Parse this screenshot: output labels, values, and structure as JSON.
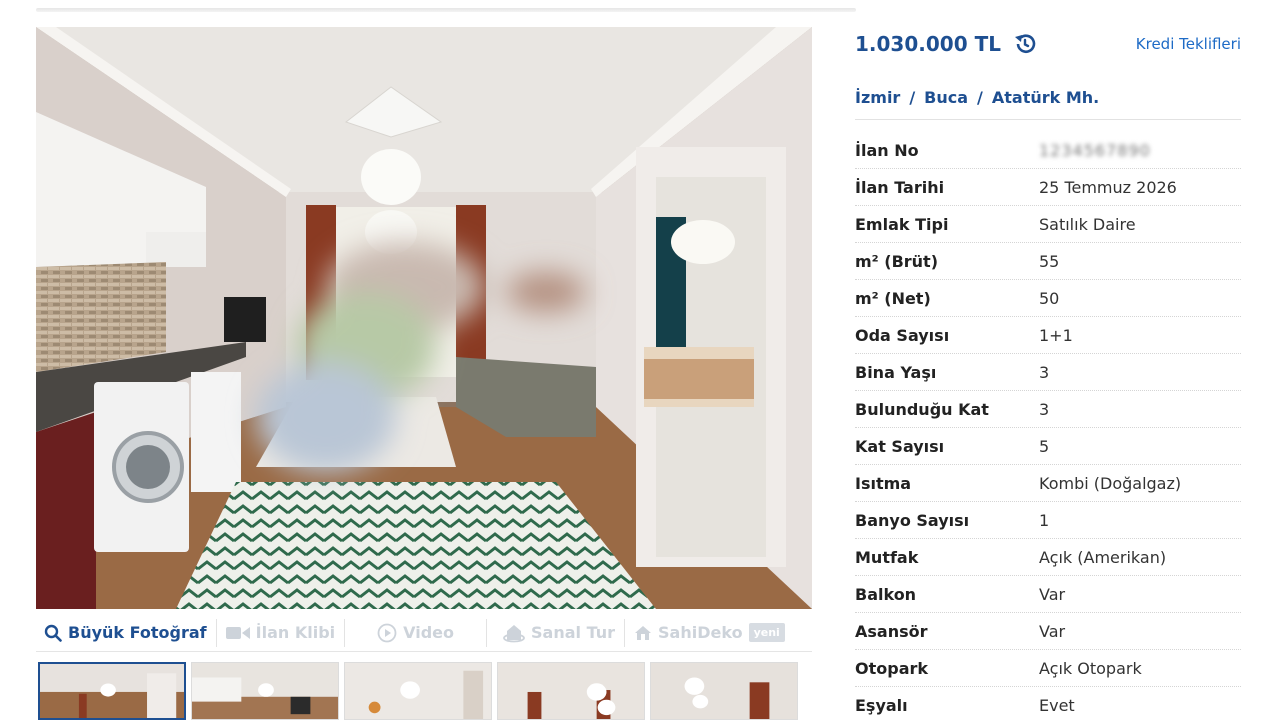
{
  "listing": {
    "price": "1.030.000 TL",
    "price_history_icon": "history-icon",
    "loan_link": "Kredi Teklifleri",
    "breadcrumb": [
      "İzmir",
      "Buca",
      "Atatürk Mh."
    ],
    "breadcrumb_separator": "/",
    "details": [
      {
        "label": "İlan No",
        "value": "1234567890",
        "blurred": true
      },
      {
        "label": "İlan Tarihi",
        "value": "25 Temmuz 2026"
      },
      {
        "label": "Emlak Tipi",
        "value": "Satılık Daire"
      },
      {
        "label": "m² (Brüt)",
        "value": "55"
      },
      {
        "label": "m² (Net)",
        "value": "50"
      },
      {
        "label": "Oda Sayısı",
        "value": "1+1"
      },
      {
        "label": "Bina Yaşı",
        "value": "3"
      },
      {
        "label": "Bulunduğu Kat",
        "value": "3"
      },
      {
        "label": "Kat Sayısı",
        "value": "5"
      },
      {
        "label": "Isıtma",
        "value": "Kombi (Doğalgaz)"
      },
      {
        "label": "Banyo Sayısı",
        "value": "1"
      },
      {
        "label": "Mutfak",
        "value": "Açık (Amerikan)"
      },
      {
        "label": "Balkon",
        "value": "Var"
      },
      {
        "label": "Asansör",
        "value": "Var"
      },
      {
        "label": "Otopark",
        "value": "Açık Otopark"
      },
      {
        "label": "Eşyalı",
        "value": "Evet"
      }
    ]
  },
  "media_bar": {
    "big_photo": "Büyük Fotoğraf",
    "video_clip": "İlan Klibi",
    "video": "Video",
    "virtual_tour": "Sanal Tur",
    "sahideko": "SahiDeko",
    "new_badge": "yeni"
  },
  "colors": {
    "brand_blue": "#1e4f91",
    "link_blue": "#1e6bc6",
    "disabled_gray": "#cdd3da"
  }
}
